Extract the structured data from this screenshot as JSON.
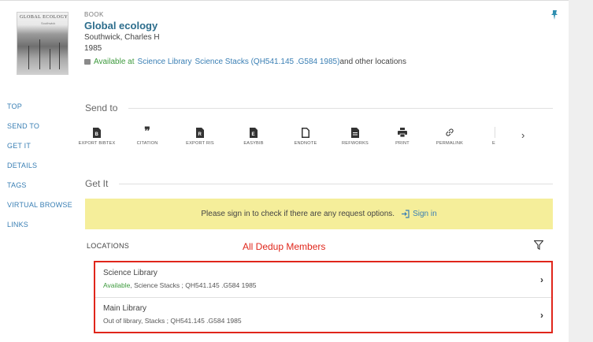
{
  "record": {
    "type": "BOOK",
    "title": "Global ecology",
    "author": "Southwick, Charles H",
    "year": "1985",
    "availability": {
      "status": "Available at",
      "library": "Science Library",
      "location": "Science Stacks (QH541.145 .G584 1985)",
      "more": "and other locations"
    },
    "cover": {
      "title": "GLOBAL ECOLOGY",
      "subtitle": "Southwick"
    }
  },
  "nav": [
    "TOP",
    "SEND TO",
    "GET IT",
    "DETAILS",
    "TAGS",
    "VIRTUAL BROWSE",
    "LINKS"
  ],
  "send_to": {
    "heading": "Send to",
    "items": [
      {
        "label": "EXPORT BIBTEX",
        "icon": "bibtex-icon"
      },
      {
        "label": "CITATION",
        "icon": "quote-icon"
      },
      {
        "label": "EXPORT RIS",
        "icon": "ris-icon"
      },
      {
        "label": "EASYBIB",
        "icon": "easybib-icon"
      },
      {
        "label": "ENDNOTE",
        "icon": "document-icon"
      },
      {
        "label": "REFWORKS",
        "icon": "refworks-icon"
      },
      {
        "label": "PRINT",
        "icon": "printer-icon"
      },
      {
        "label": "PERMALINK",
        "icon": "link-icon"
      },
      {
        "label": "E",
        "icon": "email-icon"
      }
    ],
    "next": "›"
  },
  "get_it": {
    "heading": "Get It",
    "banner_text": "Please sign in to check if there are any request options.",
    "signin_label": "Sign in"
  },
  "locations": {
    "heading": "LOCATIONS",
    "annotation": "All Dedup Members",
    "items": [
      {
        "name": "Science Library",
        "status": "Available",
        "details": ", Science Stacks ; QH541.145 .G584 1985"
      },
      {
        "name": "Main Library",
        "status": "Out of library",
        "details": ", Stacks ; QH541.145 .G584 1985"
      }
    ]
  },
  "colors": {
    "link": "#3a7fb4",
    "title": "#2c6d8c",
    "available": "#3d9a3d",
    "banner": "#f5ee9a",
    "highlight": "#e0261b"
  }
}
